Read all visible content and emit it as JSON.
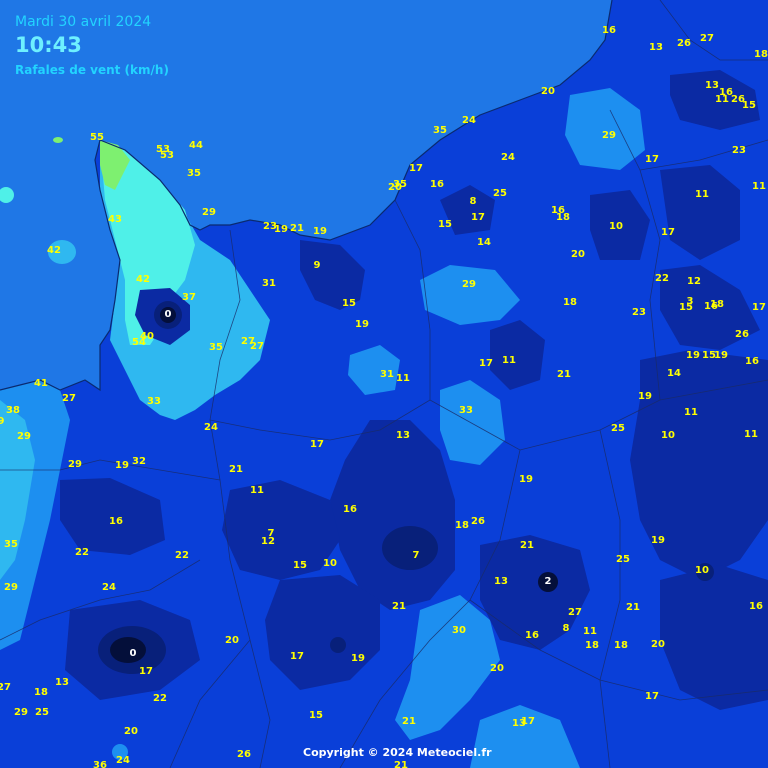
{
  "header": {
    "date": "Mardi 30 avril 2024",
    "time": "10:43",
    "parameter": "Rafales de vent (km/h)"
  },
  "copyright": "Copyright © 2024 Meteociel.fr",
  "colors": {
    "sea": "#1f77e6",
    "land_base": "#0a3fd8",
    "dark_zone": "#0b2aa3",
    "light_zone": "#1d8ff0",
    "cyan_zone": "#4ff0e8",
    "green_zone": "#7ef070",
    "label": "#ffff00"
  },
  "gust_labels": [
    "16",
    "13",
    "27",
    "26",
    "18",
    "13",
    "16",
    "11",
    "26",
    "15",
    "20",
    "24",
    "29",
    "35",
    "17",
    "23",
    "55",
    "53",
    "53",
    "44",
    "35",
    "24",
    "17",
    "16",
    "25",
    "11",
    "20",
    "35",
    "29",
    "8",
    "17",
    "16",
    "18",
    "15",
    "14",
    "10",
    "17",
    "11",
    "43",
    "23",
    "19",
    "21",
    "19",
    "20",
    "9",
    "22",
    "12",
    "42",
    "31",
    "15",
    "29",
    "18",
    "3",
    "15",
    "18",
    "17",
    "42",
    "37",
    "19",
    "23",
    "0",
    "40",
    "54",
    "35",
    "27",
    "27",
    "16",
    "26",
    "19",
    "15",
    "19",
    "16",
    "31",
    "11",
    "17",
    "11",
    "21",
    "14",
    "41",
    "27",
    "33",
    "33",
    "19",
    "11",
    "38",
    "9",
    "29",
    "24",
    "13",
    "25",
    "10",
    "11",
    "17",
    "29",
    "19",
    "32",
    "21",
    "19",
    "11",
    "16",
    "16",
    "18",
    "26",
    "7",
    "12",
    "35",
    "22",
    "22",
    "21",
    "7",
    "19",
    "15",
    "10",
    "13",
    "2",
    "25",
    "29",
    "24",
    "10",
    "16",
    "21",
    "27",
    "8",
    "11",
    "20",
    "18",
    "18",
    "0",
    "30",
    "16",
    "21",
    "17",
    "19",
    "17",
    "20",
    "20",
    "22",
    "18",
    "13",
    "27",
    "29",
    "20",
    "17",
    "25",
    "15",
    "21",
    "13",
    "17",
    "24",
    "26",
    "36",
    "21"
  ],
  "dark_cell_labels": [
    "0",
    "0",
    "2",
    "7",
    "8",
    "10",
    "8"
  ]
}
